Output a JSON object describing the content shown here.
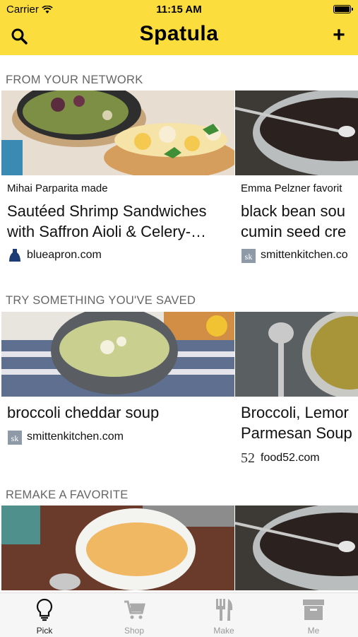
{
  "status_bar": {
    "carrier": "Carrier",
    "time": "11:15 AM"
  },
  "nav": {
    "title": "Spatula",
    "search_icon": "search-icon",
    "add_icon": "plus-icon",
    "add_label": "+"
  },
  "sections": [
    {
      "title": "FROM YOUR NETWORK",
      "cards": [
        {
          "subtitle": "Mihai Parparita made",
          "title_line1": "Sautéed Shrimp Sandwiches",
          "title_line2": "with Saffron Aioli & Celery-…",
          "source": "blueapron.com",
          "logo": "blueapron-logo"
        },
        {
          "subtitle": "Emma Pelzner favorit",
          "title_line1": "black bean sou",
          "title_line2": "cumin seed cre",
          "source": "smittenkitchen.co",
          "logo": "smittenkitchen-logo"
        }
      ]
    },
    {
      "title": "TRY SOMETHING YOU'VE SAVED",
      "cards": [
        {
          "title_line1": "broccoli cheddar soup",
          "source": "smittenkitchen.com",
          "logo": "smittenkitchen-logo"
        },
        {
          "title_line1": "Broccoli, Lemor",
          "title_line2": "Parmesan Soup",
          "source": "food52.com",
          "logo": "food52-logo",
          "logo_text": "52"
        }
      ]
    },
    {
      "title": "REMAKE A FAVORITE",
      "cards": []
    }
  ],
  "tabs": [
    {
      "label": "Pick",
      "icon": "lightbulb-icon",
      "active": true
    },
    {
      "label": "Shop",
      "icon": "cart-icon",
      "active": false
    },
    {
      "label": "Make",
      "icon": "utensils-icon",
      "active": false
    },
    {
      "label": "Me",
      "icon": "box-icon",
      "active": false
    }
  ],
  "colors": {
    "header": "#fbdd3e",
    "tabbar": "#f6f6f6"
  }
}
